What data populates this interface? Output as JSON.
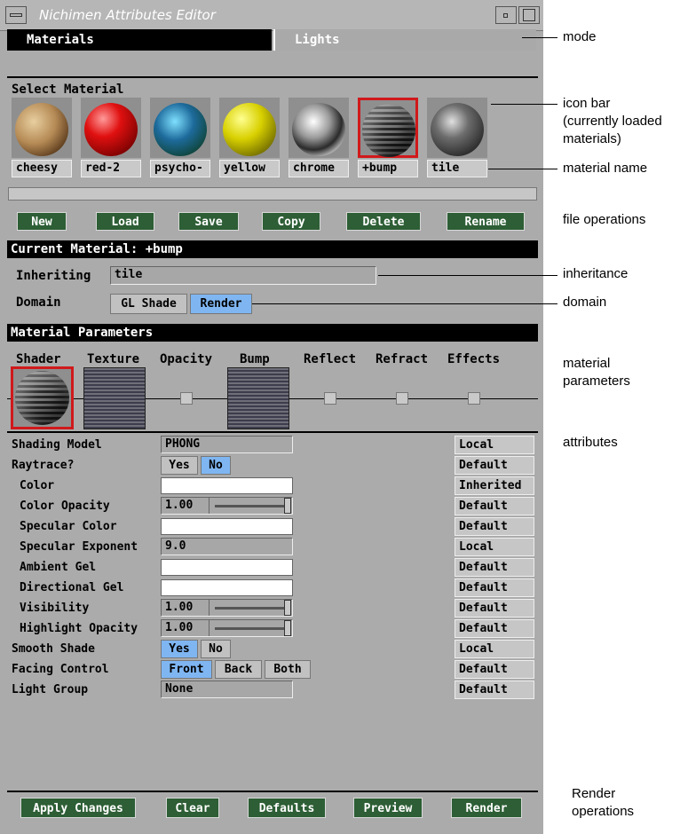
{
  "window": {
    "title": "Nichimen Attributes Editor"
  },
  "tabs": [
    {
      "label": "Materials"
    },
    {
      "label": "Lights"
    }
  ],
  "select_material": {
    "label": "Select Material",
    "items": [
      {
        "name": "cheesy"
      },
      {
        "name": "red-2"
      },
      {
        "name": "psycho-"
      },
      {
        "name": "yellow"
      },
      {
        "name": "chrome"
      },
      {
        "name": "+bump"
      },
      {
        "name": "tile"
      }
    ]
  },
  "file_ops": {
    "new": "New",
    "load": "Load",
    "save": "Save",
    "copy": "Copy",
    "delete": "Delete",
    "rename": "Rename"
  },
  "current": {
    "header": "Current Material: +bump",
    "inheriting_label": "Inheriting",
    "inheriting_value": "tile",
    "domain_label": "Domain",
    "domain_options": [
      "GL Shade",
      "Render"
    ]
  },
  "params": {
    "header": "Material Parameters",
    "columns": [
      "Shader",
      "Texture",
      "Opacity",
      "Bump",
      "Reflect",
      "Refract",
      "Effects"
    ]
  },
  "attributes": {
    "shading_model": {
      "label": "Shading Model",
      "value": "PHONG",
      "scope": "Local"
    },
    "raytrace": {
      "label": "Raytrace?",
      "yes": "Yes",
      "no": "No",
      "scope": "Default"
    },
    "color": {
      "label": "Color",
      "scope": "Inherited"
    },
    "color_opacity": {
      "label": "Color Opacity",
      "value": "1.00",
      "scope": "Default"
    },
    "specular_color": {
      "label": "Specular Color",
      "scope": "Default"
    },
    "specular_exponent": {
      "label": "Specular Exponent",
      "value": "9.0",
      "scope": "Local"
    },
    "ambient_gel": {
      "label": "Ambient Gel",
      "scope": "Default"
    },
    "directional_gel": {
      "label": "Directional Gel",
      "scope": "Default"
    },
    "visibility": {
      "label": "Visibility",
      "value": "1.00",
      "scope": "Default"
    },
    "highlight_opacity": {
      "label": "Highlight Opacity",
      "value": "1.00",
      "scope": "Default"
    },
    "smooth_shade": {
      "label": "Smooth Shade",
      "yes": "Yes",
      "no": "No",
      "scope": "Local"
    },
    "facing_control": {
      "label": "Facing Control",
      "front": "Front",
      "back": "Back",
      "both": "Both",
      "scope": "Default"
    },
    "light_group": {
      "label": "Light Group",
      "value": "None",
      "scope": "Default"
    }
  },
  "render_ops": {
    "apply": "Apply Changes",
    "clear": "Clear",
    "defaults": "Defaults",
    "preview": "Preview",
    "render": "Render"
  },
  "annotations": {
    "mode": "mode",
    "icon_bar_1": "icon bar",
    "icon_bar_2": "(currently loaded",
    "icon_bar_3": "materials)",
    "material_name": "material name",
    "file_operations": "file operations",
    "inheritance": "inheritance",
    "domain": "domain",
    "material_parameters_1": "material",
    "material_parameters_2": "parameters",
    "attributes": "attributes",
    "render_operations_1": "Render",
    "render_operations_2": "operations"
  },
  "colors": {
    "accent_selected": "#d0191b",
    "toggle_on": "#7fb6f2",
    "button_green": "#2d5e35"
  }
}
